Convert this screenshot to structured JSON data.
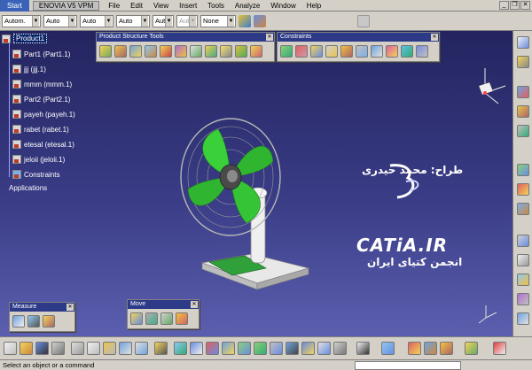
{
  "menubar": {
    "start": "Start",
    "app_title": "ENOVIA V5 VPM",
    "items": [
      "File",
      "Edit",
      "View",
      "Insert",
      "Tools",
      "Analyze",
      "Window",
      "Help"
    ]
  },
  "toolbar": {
    "combos": [
      {
        "value": "Autom.",
        "disabled": false
      },
      {
        "value": "Auto",
        "disabled": false
      },
      {
        "value": "Auto",
        "disabled": false
      },
      {
        "value": "Auto",
        "disabled": false
      },
      {
        "value": "Aut",
        "disabled": false
      },
      {
        "value": "Aut",
        "disabled": true
      },
      {
        "value": "None",
        "disabled": false
      }
    ]
  },
  "tree": {
    "root": "Product1",
    "children": [
      "Part1 (Part1.1)",
      "jjj (jjj.1)",
      "mmm (mmm.1)",
      "Part2 (Part2.1)",
      "payeh (payeh.1)",
      "rabet (rabet.1)",
      "etesal (etesal.1)",
      "jeloii (jeloii.1)",
      "Constraints"
    ],
    "applications": "Applications"
  },
  "palettes": {
    "product_structure": "Product Structure Tools",
    "constraints": "Constraints",
    "measure": "Measure",
    "move": "Move"
  },
  "brand": {
    "designer": "طراح: محمد حیدری",
    "site": "CATiA.IR",
    "farsi": "انجمن کتیای ایران"
  },
  "status": {
    "message": "Select an object or a command"
  },
  "colors": {
    "background_top": "#23245f",
    "background_bottom": "#5b5fae",
    "fan_blade": "#2fb52f",
    "title_bar": "#2d3a88",
    "chrome": "#d4d0c8"
  }
}
